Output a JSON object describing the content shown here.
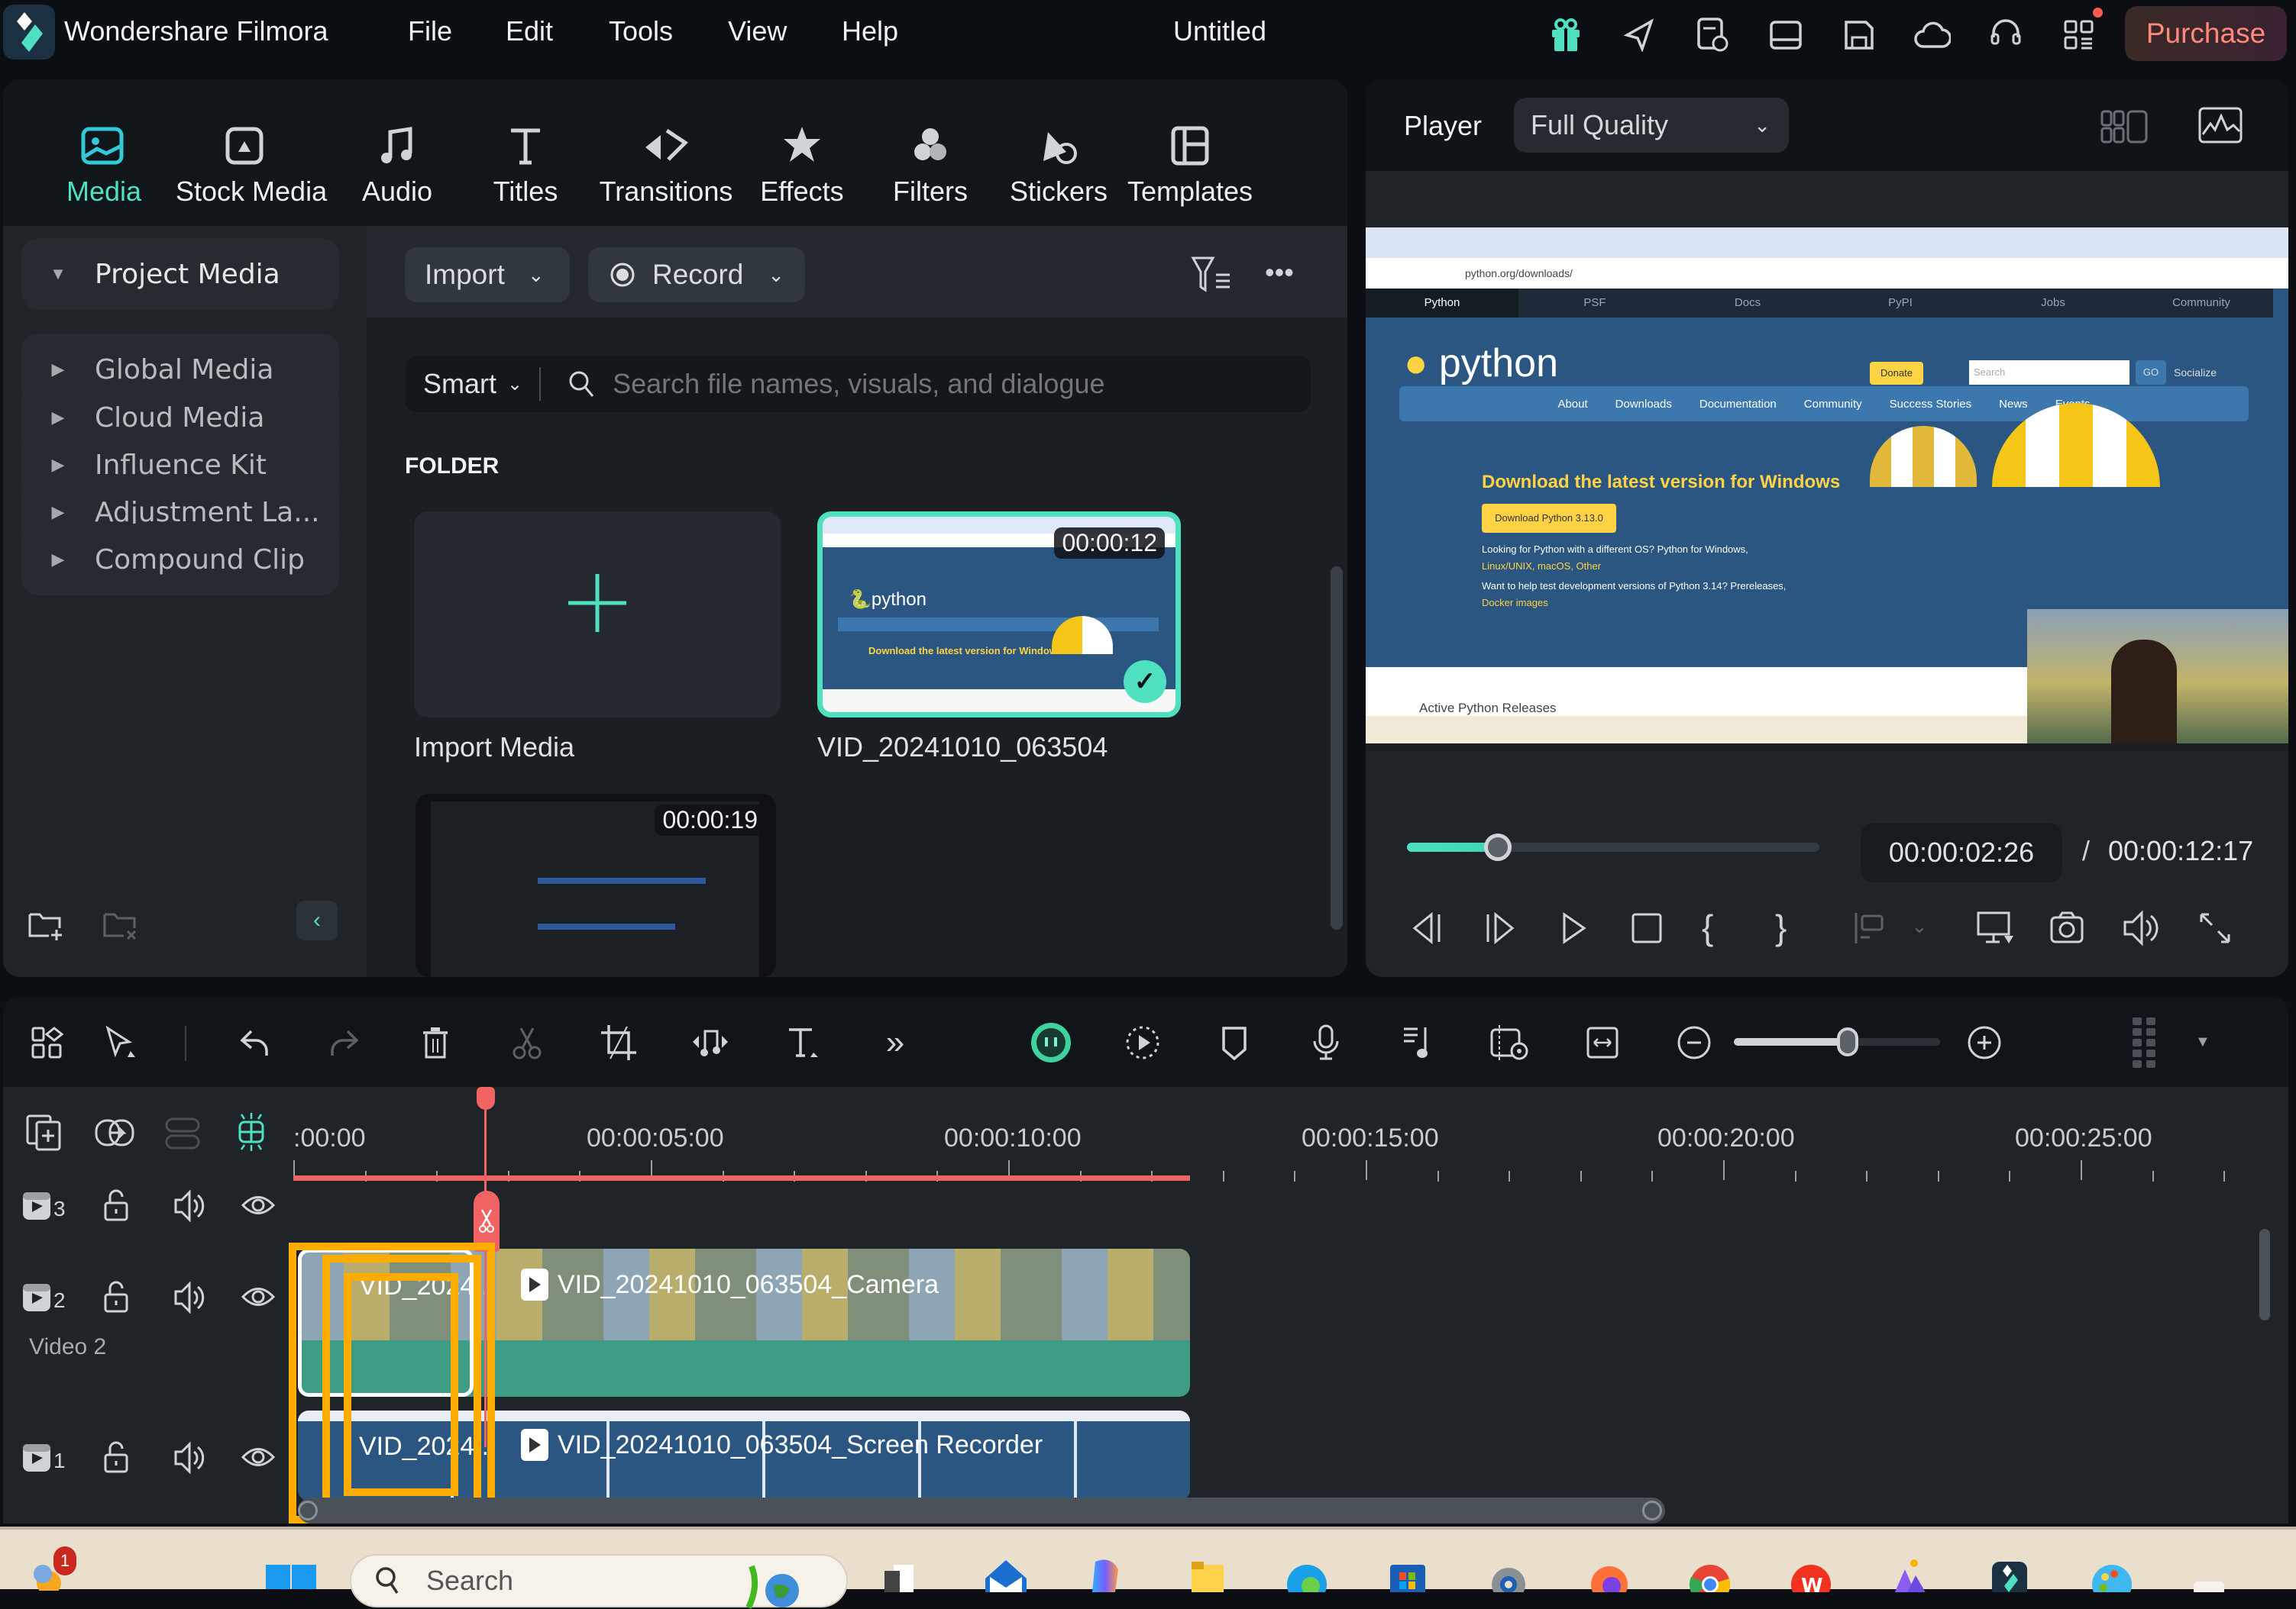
{
  "titlebar": {
    "app_name": "Wondershare Filmora",
    "menu": [
      "File",
      "Edit",
      "Tools",
      "View",
      "Help"
    ],
    "document_title": "Untitled",
    "icons": [
      "gift-icon",
      "send-feedback-icon",
      "task-schedule-icon",
      "layout-icon",
      "save-icon",
      "cloud-sync-icon",
      "support-headset-icon",
      "apps-grid-icon"
    ],
    "purchase_label": "Purchase",
    "accent": "#4fe0bf"
  },
  "categories": [
    {
      "label": "Media",
      "icon": "media-icon",
      "active": true
    },
    {
      "label": "Stock Media",
      "icon": "stock-media-icon"
    },
    {
      "label": "Audio",
      "icon": "music-note-icon"
    },
    {
      "label": "Titles",
      "icon": "text-t-icon"
    },
    {
      "label": "Transitions",
      "icon": "transitions-icon"
    },
    {
      "label": "Effects",
      "icon": "effects-star-icon"
    },
    {
      "label": "Filters",
      "icon": "filters-icon"
    },
    {
      "label": "Stickers",
      "icon": "stickers-icon"
    },
    {
      "label": "Templates",
      "icon": "templates-icon"
    }
  ],
  "sidebar": {
    "items": [
      {
        "label": "Project Media",
        "expanded": true
      },
      {
        "label": "Global Media"
      },
      {
        "label": "Cloud Media"
      },
      {
        "label": "Influence Kit"
      },
      {
        "label": "Adjustment La..."
      },
      {
        "label": "Compound Clip"
      }
    ],
    "sub_item": "Folder"
  },
  "media": {
    "import_label": "Import",
    "record_label": "Record",
    "smart_label": "Smart",
    "search_placeholder": "Search file names, visuals, and dialogue",
    "section_heading": "FOLDER",
    "import_media_label": "Import Media",
    "items": [
      {
        "name": "VID_20241010_063504",
        "duration": "00:00:12",
        "selected": true
      },
      {
        "name": "",
        "duration": "00:00:19"
      }
    ]
  },
  "player": {
    "label": "Player",
    "quality": "Full Quality",
    "current_time": "00:00:02:26",
    "separator": "/",
    "total_time": "00:00:12:17",
    "progress_fraction": 0.22,
    "preview": {
      "url": "python.org/downloads/",
      "top_tabs": [
        "Python",
        "PSF",
        "Docs",
        "PyPI",
        "Jobs",
        "Community"
      ],
      "donate": "Donate",
      "search_placeholder": "Search",
      "go": "GO",
      "socialize": "Socialize",
      "nav": [
        "About",
        "Downloads",
        "Documentation",
        "Community",
        "Success Stories",
        "News",
        "Events"
      ],
      "headline": "Download the latest version for Windows",
      "download_button": "Download Python 3.13.0",
      "line1": "Looking for Python with a different OS? Python for Windows,",
      "line2": "Linux/UNIX, macOS, Other",
      "line3": "Want to help test development versions of Python 3.14? Prereleases,",
      "line4": "Docker images",
      "releases": "Active Python Releases"
    }
  },
  "timeline": {
    "ruler_labels": [
      ":00:00",
      "00:00:05:00",
      "00:00:10:00",
      "00:00:15:00",
      "00:00:20:00",
      "00:00:25:00"
    ],
    "zoom_fraction": 0.55,
    "tracks": [
      {
        "number": "3",
        "name": ""
      },
      {
        "number": "2",
        "name": "Video 2",
        "clip_short": "VID_2024...",
        "clip": "VID_20241010_063504_Camera"
      },
      {
        "number": "1",
        "name": "",
        "clip_short": "VID_2024...",
        "clip": "VID_20241010_063504_Screen Recorder"
      }
    ]
  },
  "taskbar": {
    "search_placeholder": "Search",
    "badge": "1"
  }
}
